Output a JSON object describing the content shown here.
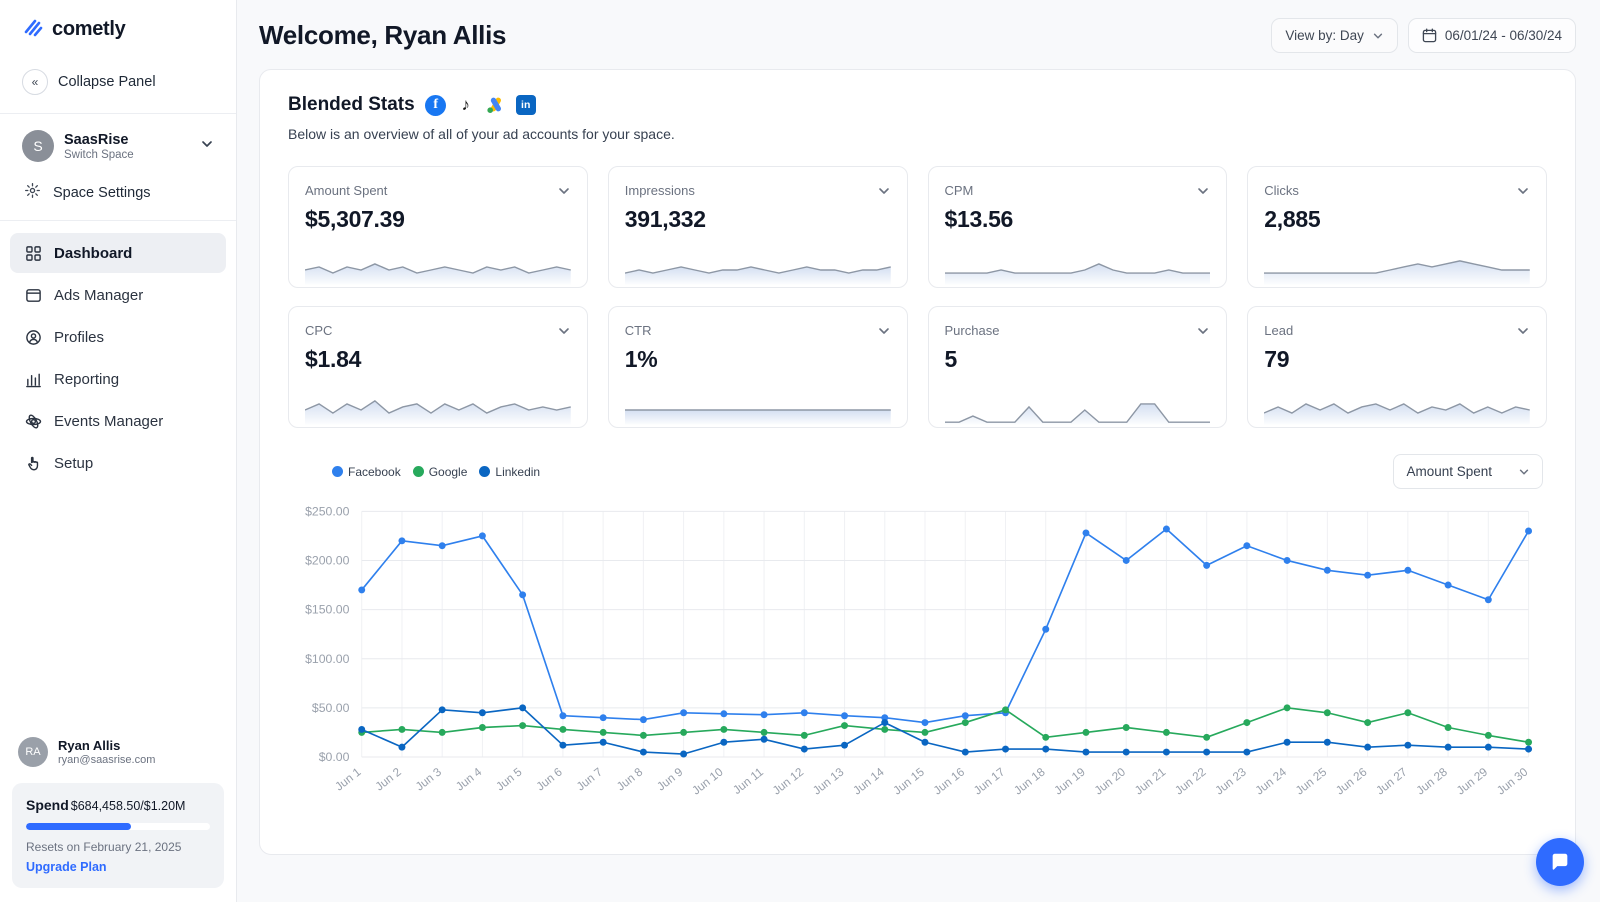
{
  "app": {
    "brand": "cometly"
  },
  "sidebar": {
    "collapse_label": "Collapse Panel",
    "space": {
      "initial": "S",
      "name": "SaasRise",
      "switch_label": "Switch Space"
    },
    "space_settings_label": "Space Settings",
    "nav": [
      {
        "label": "Dashboard",
        "icon": "dashboard",
        "active": true
      },
      {
        "label": "Ads Manager",
        "icon": "ads",
        "active": false
      },
      {
        "label": "Profiles",
        "icon": "profiles",
        "active": false
      },
      {
        "label": "Reporting",
        "icon": "reporting",
        "active": false
      },
      {
        "label": "Events Manager",
        "icon": "events",
        "active": false
      },
      {
        "label": "Setup",
        "icon": "setup",
        "active": false
      }
    ],
    "user": {
      "initials": "RA",
      "name": "Ryan Allis",
      "email": "ryan@saasrise.com"
    },
    "spend": {
      "label": "Spend",
      "value": "$684,458.50/$1.20M",
      "progress_pct": 57,
      "resets": "Resets on February 21, 2025",
      "upgrade_label": "Upgrade Plan"
    }
  },
  "header": {
    "title": "Welcome, Ryan Allis",
    "view_by": "View by: Day",
    "date_range": "06/01/24 - 06/30/24"
  },
  "blended": {
    "title": "Blended Stats",
    "subtitle": "Below is an overview of all of your ad accounts for your space.",
    "platform_icons": [
      "facebook-icon",
      "tiktok-icon",
      "google-ads-icon",
      "linkedin-icon"
    ]
  },
  "stats": [
    {
      "label": "Amount Spent",
      "value": "$5,307.39",
      "spark": [
        4,
        5,
        3,
        5,
        4,
        6,
        4,
        5,
        3,
        4,
        5,
        4,
        3,
        5,
        4,
        5,
        3,
        4,
        5,
        4
      ]
    },
    {
      "label": "Impressions",
      "value": "391,332",
      "spark": [
        3,
        4,
        3,
        4,
        5,
        4,
        3,
        4,
        4,
        5,
        4,
        3,
        4,
        5,
        4,
        4,
        3,
        4,
        4,
        5
      ]
    },
    {
      "label": "CPM",
      "value": "$13.56",
      "spark": [
        3,
        3,
        3,
        3,
        4,
        3,
        3,
        3,
        3,
        3,
        4,
        6,
        4,
        3,
        3,
        3,
        4,
        3,
        3,
        3
      ]
    },
    {
      "label": "Clicks",
      "value": "2,885",
      "spark": [
        3,
        3,
        3,
        3,
        3,
        3,
        3,
        3,
        3,
        4,
        5,
        6,
        5,
        6,
        7,
        6,
        5,
        4,
        4,
        4
      ]
    },
    {
      "label": "CPC",
      "value": "$1.84",
      "spark": [
        4,
        6,
        3,
        6,
        4,
        7,
        3,
        5,
        6,
        3,
        6,
        4,
        6,
        3,
        5,
        6,
        4,
        5,
        4,
        5
      ]
    },
    {
      "label": "CTR",
      "value": "1%",
      "spark": [
        4,
        4,
        4,
        4,
        4,
        4,
        4,
        4,
        4,
        4,
        4,
        4,
        4,
        4,
        4,
        4,
        4,
        4,
        4,
        4
      ]
    },
    {
      "label": "Purchase",
      "value": "5",
      "spark": [
        0,
        0,
        2,
        0,
        0,
        0,
        5,
        0,
        0,
        0,
        4,
        0,
        0,
        0,
        6,
        6,
        0,
        0,
        0,
        0
      ]
    },
    {
      "label": "Lead",
      "value": "79",
      "spark": [
        3,
        5,
        3,
        6,
        4,
        6,
        3,
        5,
        6,
        4,
        6,
        3,
        5,
        4,
        6,
        3,
        5,
        3,
        5,
        4
      ]
    }
  ],
  "chart_controls": {
    "metric_select": "Amount Spent"
  },
  "chart_data": {
    "type": "line",
    "x": [
      "Jun 1",
      "Jun 2",
      "Jun 3",
      "Jun 4",
      "Jun 5",
      "Jun 6",
      "Jun 7",
      "Jun 8",
      "Jun 9",
      "Jun 10",
      "Jun 11",
      "Jun 12",
      "Jun 13",
      "Jun 14",
      "Jun 15",
      "Jun 16",
      "Jun 17",
      "Jun 18",
      "Jun 19",
      "Jun 20",
      "Jun 21",
      "Jun 22",
      "Jun 23",
      "Jun 24",
      "Jun 25",
      "Jun 26",
      "Jun 27",
      "Jun 28",
      "Jun 29",
      "Jun 30"
    ],
    "series": [
      {
        "name": "Facebook",
        "color": "#2f80ed",
        "values": [
          170,
          220,
          215,
          225,
          165,
          42,
          40,
          38,
          45,
          44,
          43,
          45,
          42,
          40,
          35,
          42,
          45,
          130,
          228,
          200,
          232,
          195,
          215,
          200,
          190,
          185,
          190,
          175,
          160,
          230
        ]
      },
      {
        "name": "Google",
        "color": "#27a95c",
        "values": [
          25,
          28,
          25,
          30,
          32,
          28,
          25,
          22,
          25,
          28,
          25,
          22,
          32,
          28,
          25,
          35,
          48,
          20,
          25,
          30,
          25,
          20,
          35,
          50,
          45,
          35,
          45,
          30,
          22,
          15
        ]
      },
      {
        "name": "Linkedin",
        "color": "#0a66c2",
        "values": [
          28,
          10,
          48,
          45,
          50,
          12,
          15,
          5,
          3,
          15,
          18,
          8,
          12,
          35,
          15,
          5,
          8,
          8,
          5,
          5,
          5,
          5,
          5,
          15,
          15,
          10,
          12,
          10,
          10,
          8
        ]
      }
    ],
    "ytick_labels": [
      "$0.00",
      "$50.00",
      "$100.00",
      "$150.00",
      "$200.00",
      "$250.00"
    ],
    "ylim": [
      0,
      250
    ],
    "grid": true,
    "legend_position": "top-left"
  }
}
